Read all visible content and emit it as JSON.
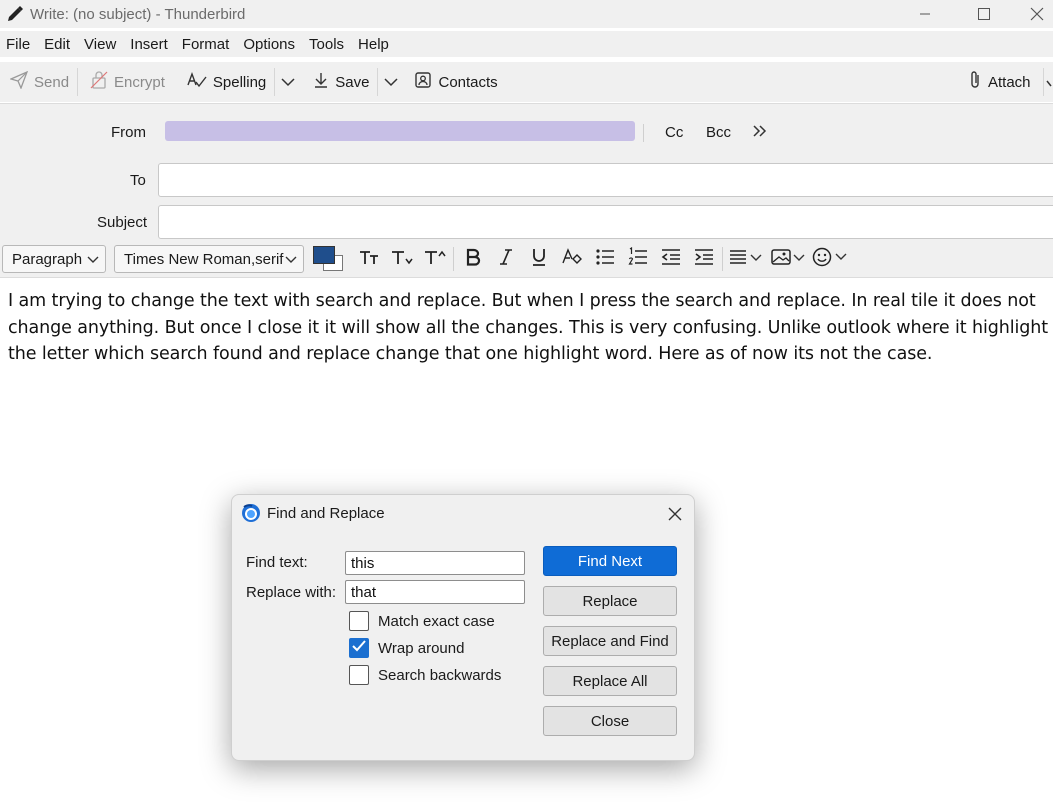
{
  "window": {
    "title": "Write: (no subject) - Thunderbird"
  },
  "menu": [
    "File",
    "Edit",
    "View",
    "Insert",
    "Format",
    "Options",
    "Tools",
    "Help"
  ],
  "toolbar": {
    "send": "Send",
    "encrypt": "Encrypt",
    "spelling": "Spelling",
    "save": "Save",
    "contacts": "Contacts",
    "attach": "Attach"
  },
  "header": {
    "from_label": "From",
    "cc": "Cc",
    "bcc": "Bcc",
    "to_label": "To",
    "to_value": "",
    "subject_label": "Subject",
    "subject_value": ""
  },
  "format": {
    "paragraph": "Paragraph",
    "font": "Times New Roman,serif",
    "text_color": "#1f4e8c",
    "bg_color": "#ffffff"
  },
  "body": {
    "text": "I am trying to change the text with search and replace. But when I press the search and replace. In real tile it does not change anything. But once I close it it will show all the changes. This is very confusing. Unlike outlook where it highlight the letter which search found and replace change that one highlight word. Here as of now its not the case."
  },
  "dialog": {
    "title": "Find and Replace",
    "find_label": "Find text:",
    "find_value": "this",
    "replace_label": "Replace with:",
    "replace_value": "that",
    "match_case_label": "Match exact case",
    "match_case_checked": false,
    "wrap_label": "Wrap around",
    "wrap_checked": true,
    "backwards_label": "Search backwards",
    "backwards_checked": false,
    "find_next": "Find Next",
    "replace": "Replace",
    "replace_and_find": "Replace and Find",
    "replace_all": "Replace All",
    "close": "Close"
  },
  "colors": {
    "accent": "#0f6cd6",
    "from_redacted": "#c7bfe6"
  }
}
